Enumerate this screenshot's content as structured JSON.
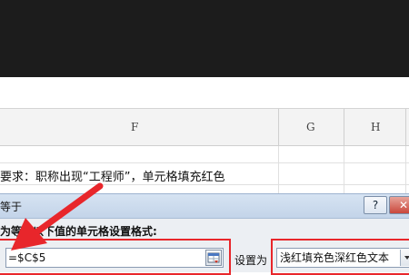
{
  "spreadsheet": {
    "columns": [
      {
        "label": "F"
      },
      {
        "label": "G"
      },
      {
        "label": "H"
      }
    ],
    "requirement_text": "要求：职称出现“工程师”，单元格填充红色"
  },
  "dialog": {
    "title": "等于",
    "help_label": "?",
    "close_label": "✕",
    "instruction": "为等于以下值的单元格设置格式:",
    "formula_value": "=$C$5",
    "set_label": "设置为",
    "format_value": "浅红填充色深红色文本"
  },
  "colors": {
    "highlight_red": "#e8262b",
    "top_bar": "#1c1c1c"
  }
}
